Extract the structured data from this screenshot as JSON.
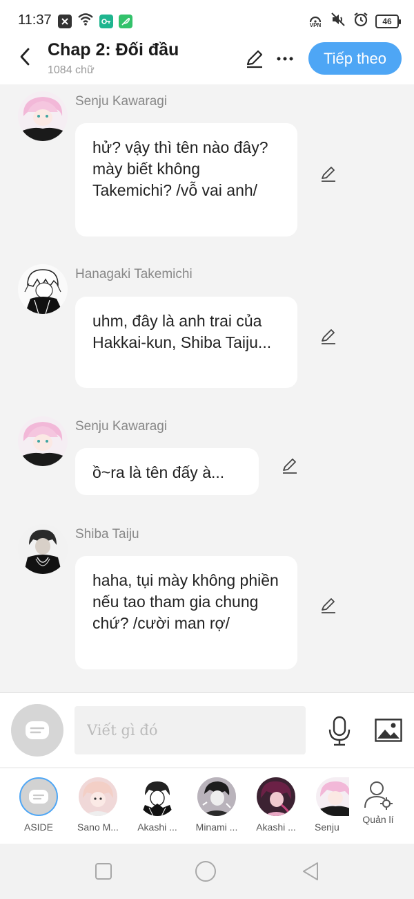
{
  "status_bar": {
    "time": "11:37",
    "battery": "46",
    "left_icons": [
      "close-box-icon",
      "wifi-icon",
      "key-icon",
      "feather-icon"
    ],
    "right_icons": [
      "vpn-icon",
      "mute-icon",
      "alarm-icon",
      "battery-icon"
    ],
    "vpn_label": "VPN"
  },
  "header": {
    "title": "Chap 2: Đối đầu",
    "word_count": "1084 chữ",
    "next_label": "Tiếp theo"
  },
  "messages": [
    {
      "name": "Senju Kawaragi",
      "text": "hử? vậy thì tên nào đây? mày biết không Takemichi? /vỗ vai anh/"
    },
    {
      "name": "Hanagaki Takemichi",
      "text": "uhm, đây là anh trai của Hakkai-kun, Shiba Taiju..."
    },
    {
      "name": "Senju Kawaragi",
      "text": "ồ~ra là tên đấy à..."
    },
    {
      "name": "Shiba Taiju",
      "text": "haha, tụi mày không phiền nếu tao tham gia chung chứ? /cười man rợ/"
    }
  ],
  "input": {
    "placeholder": "Viết gì đó"
  },
  "characters": [
    {
      "label": "ASIDE"
    },
    {
      "label": "Sano M..."
    },
    {
      "label": "Akashi ..."
    },
    {
      "label": "Minami ..."
    },
    {
      "label": "Akashi ..."
    },
    {
      "label": "Senju"
    }
  ],
  "manage_label": "Quản lí",
  "colors": {
    "accent": "#4ea6f5",
    "background": "#f3f3f3",
    "bubble": "#ffffff"
  }
}
